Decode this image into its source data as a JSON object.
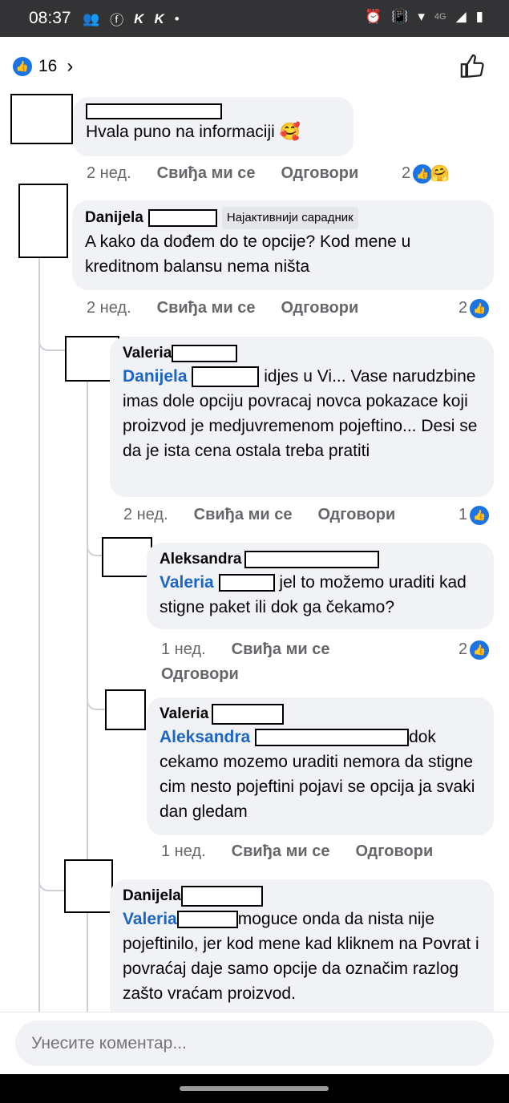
{
  "status": {
    "time": "08:37",
    "network": "4G"
  },
  "header": {
    "reactions_count": "16"
  },
  "actions": {
    "like": "Свиђа ми се",
    "reply": "Одговори"
  },
  "comments": [
    {
      "name": "",
      "text": "Hvala puno na informaciji 🥰",
      "time": "2 нед.",
      "count": "2"
    },
    {
      "name": "Danijela",
      "badge": "Најактивнији сарадник",
      "text": "A kako da dođem do te opcije? Kod mene u kreditnom balansu nema ništa",
      "time": "2 нед.",
      "count": "2"
    },
    {
      "name": "Valeria",
      "mention": "Danijela",
      "text": "idjes u Vi... Vase narudzbine  imas dole opciju povracaj novca pokazace koji proizvod je medjuvremenom pojeftino... Desi se da je ista cena ostala treba pratiti",
      "time": "2 нед.",
      "count": "1"
    },
    {
      "name": "Aleksandra",
      "mention": "Valeria",
      "text": "jel to možemo uraditi kad stigne paket ili dok ga čekamo?",
      "time": "1 нед.",
      "count": "2"
    },
    {
      "name": "Valeria",
      "mention": "Aleksandra",
      "text": "dok cekamo mozemo uraditi nemora da stigne cim nesto pojeftini pojavi se opcija ja svaki dan gledam",
      "time": "1 нед."
    },
    {
      "name": "Danijela",
      "mention": "Valeria",
      "text": "moguce onda da nista nije pojeftinilo, jer kod mene kad kliknem na Povrat i povraćaj daje samo opcije da označim razlog zašto vraćam proizvod."
    }
  ],
  "composer": {
    "placeholder": "Унесите коментар..."
  },
  "colors": {
    "accent": "#1b74e4",
    "mention": "#1b65c4",
    "bubble": "#f0f2f5",
    "status_bar": "#333335"
  },
  "icons": [
    "people-icon",
    "facebook-icon",
    "k-icon",
    "alarm-icon",
    "vibrate-icon",
    "wifi-icon",
    "signal-icon",
    "battery-icon",
    "like-icon",
    "thumbs-up-icon",
    "chevron-right-icon",
    "hug-emoji-icon"
  ]
}
